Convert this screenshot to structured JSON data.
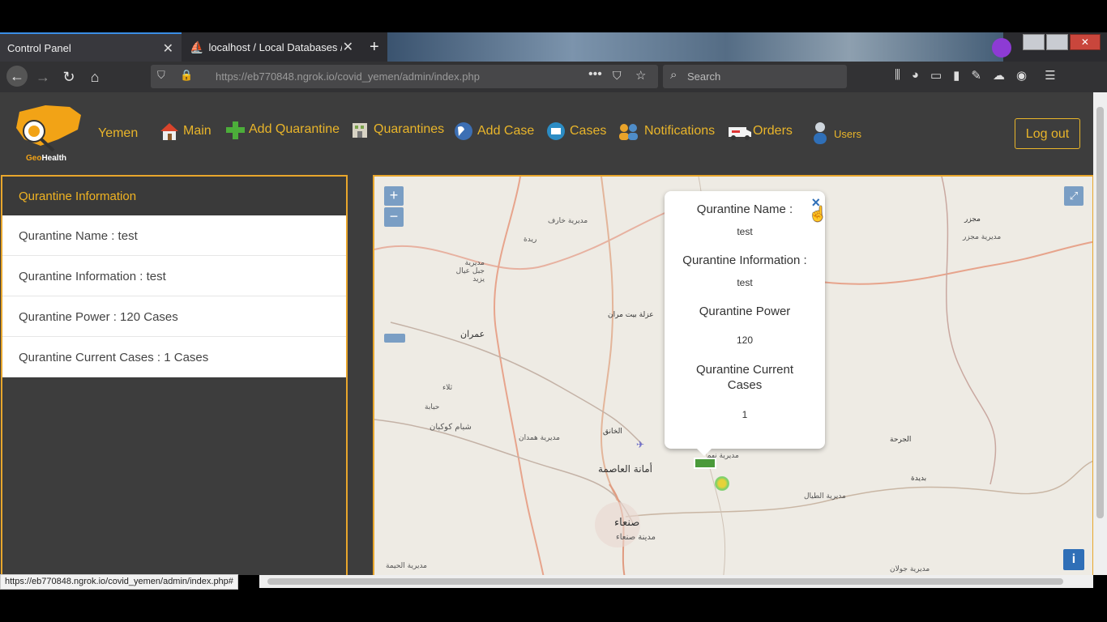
{
  "browser": {
    "tabs": [
      {
        "title": "Control Panel"
      },
      {
        "title": "localhost / Local Databases / c"
      }
    ],
    "new_tab": "+",
    "url": "https://eb770848.ngrok.io/covid_yemen/admin/index.php",
    "url_domain": "https://eb770848.ngrok.io",
    "url_path": "/covid_yemen/admin/index.php",
    "search_placeholder": "Search",
    "status_url": "https://eb770848.ngrok.io/covid_yemen/admin/index.php#"
  },
  "header": {
    "logo_text_geo": "Geo",
    "logo_text_health": "Health",
    "country": "Yemen",
    "menu": [
      {
        "label": "Main",
        "icon": "house-icon"
      },
      {
        "label": "Add Quarantine",
        "icon": "plus-icon"
      },
      {
        "label": "Quarantines",
        "icon": "building-icon"
      },
      {
        "label": "Add Case",
        "icon": "globe-icon"
      },
      {
        "label": "Cases",
        "icon": "laptop-icon"
      },
      {
        "label": "Notifications",
        "icon": "people-icon"
      },
      {
        "label": "Orders",
        "icon": "ambulance-icon"
      },
      {
        "label": "Users",
        "icon": "user-icon"
      }
    ],
    "logout": "Log out"
  },
  "panel": {
    "title": "Qurantine Information",
    "items": [
      "Qurantine Name : test",
      "Qurantine Information : test",
      "Qurantine Power : 120 Cases",
      "Qurantine Current Cases : 1 Cases"
    ]
  },
  "map": {
    "zoom_in": "+",
    "zoom_out": "−",
    "info": "i",
    "labels": [
      "مديرية خارف",
      "ريدة",
      "مديرية جبل عيال يزيد",
      "عزلة بيت مران",
      "عمران",
      "ثلاء",
      "حبابة",
      "شبام كوكبان",
      "مديرية همدان",
      "الخانق",
      "أمانة العاصمة",
      "صنعاء",
      "مدينة صنعاء",
      "مديرية الحيمة",
      "مجزر",
      "مديرية مجزر",
      "الجرحة",
      "بديدة",
      "مديرية الطيال",
      "مديرية جولان",
      "مديرية نهم"
    ],
    "popup": {
      "name_label": "Qurantine Name :",
      "name_value": "test",
      "info_label": "Qurantine Information :",
      "info_value": "test",
      "power_label": "Qurantine Power",
      "power_value": "120",
      "cases_label": "Qurantine Current Cases",
      "cases_value": "1",
      "close": "×"
    }
  },
  "colors": {
    "accent": "#e9b52a",
    "panel_border": "#e8a62c",
    "header_bg": "#3d3d3d"
  }
}
